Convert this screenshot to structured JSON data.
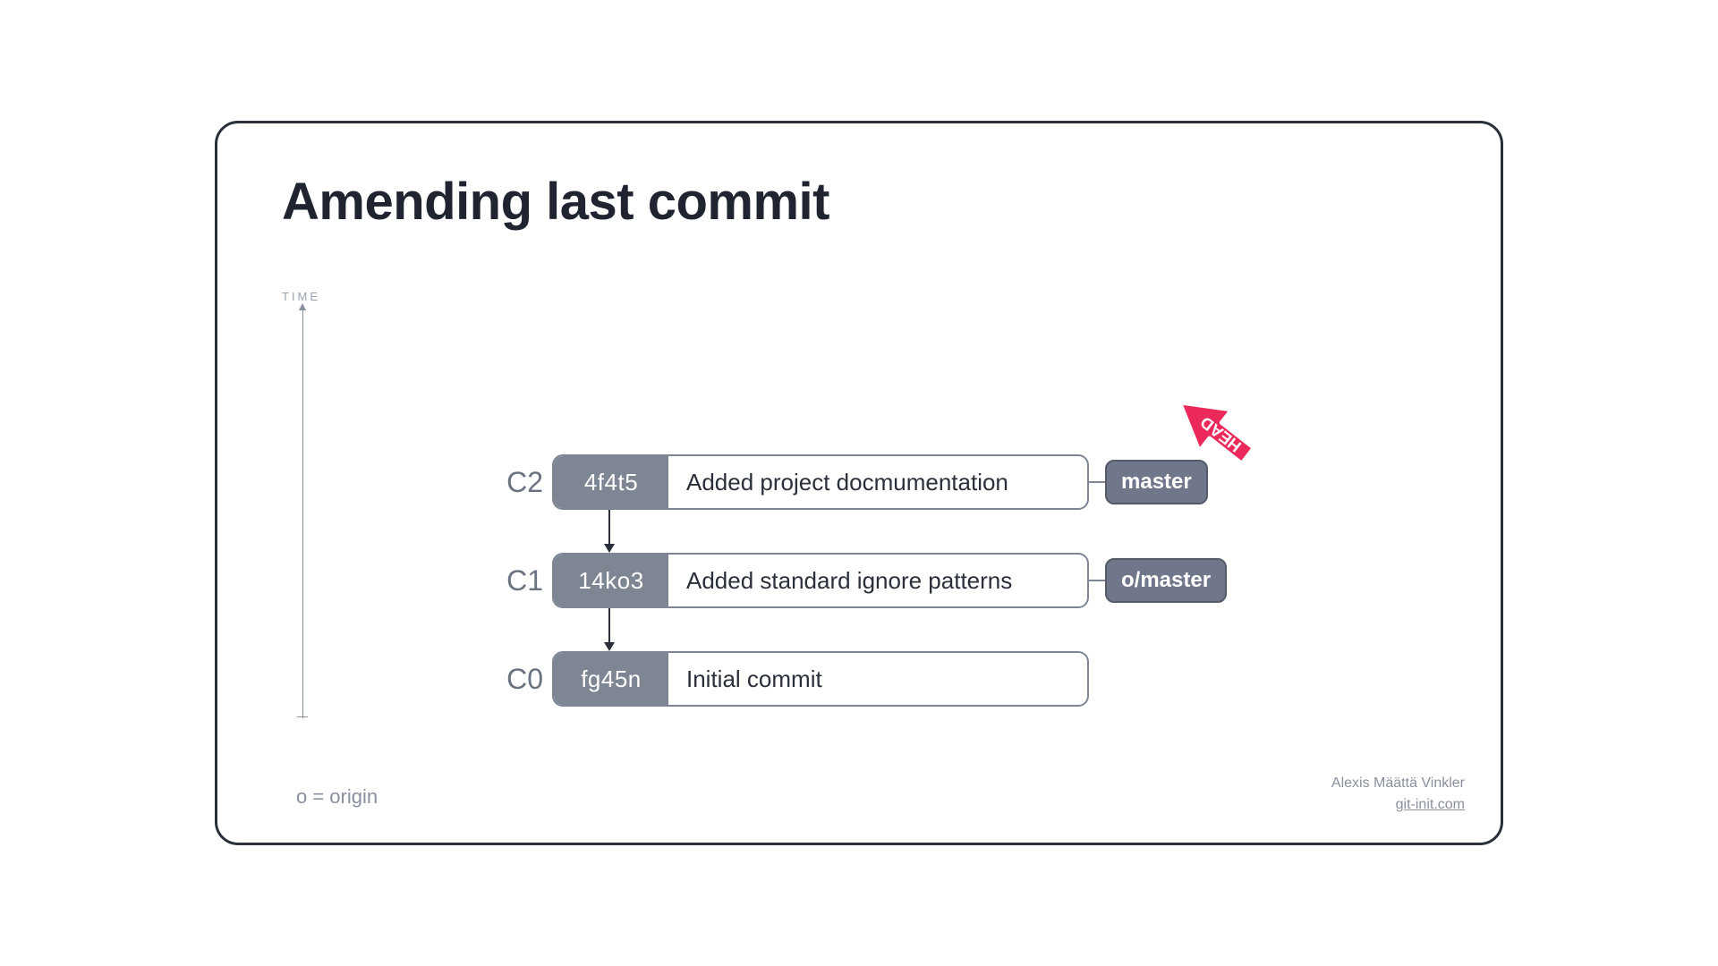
{
  "title": "Amending last commit",
  "axis_label": "TIME",
  "legend": "o = origin",
  "head_label": "HEAD",
  "commits": [
    {
      "key": "C2",
      "hash": "4f4t5",
      "message": "Added project docmumentation",
      "branch": "master",
      "head": true
    },
    {
      "key": "C1",
      "hash": "14ko3",
      "message": "Added standard ignore patterns",
      "branch": "o/master",
      "head": false
    },
    {
      "key": "C0",
      "hash": "fg45n",
      "message": "Initial commit",
      "branch": null,
      "head": false
    }
  ],
  "credits": {
    "author": "Alexis Määttä Vinkler",
    "site": "git-init.com"
  },
  "colors": {
    "accent": "#eb2a5b",
    "node": "#7e8593",
    "text_muted": "#8a909d",
    "frame": "#2a2f3a"
  }
}
